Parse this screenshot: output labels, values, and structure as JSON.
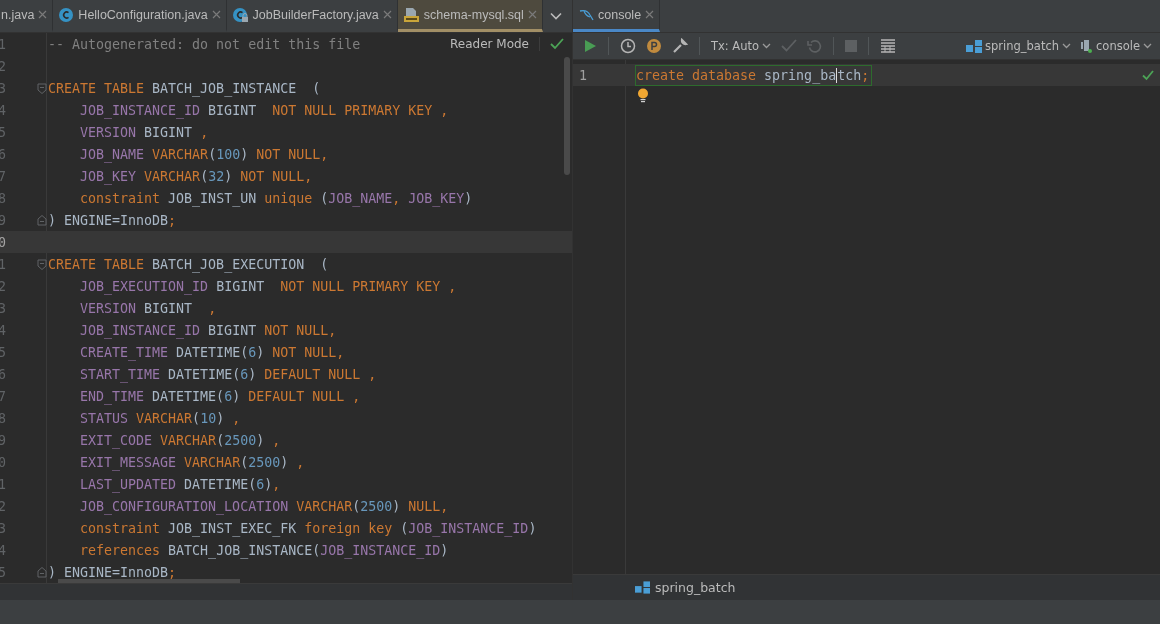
{
  "left_pane": {
    "tabs": [
      {
        "label": "n.java",
        "kind": "plain",
        "selected": false
      },
      {
        "label": "HelloConfiguration.java",
        "kind": "class",
        "selected": false
      },
      {
        "label": "JobBuilderFactory.java",
        "kind": "class-locked",
        "selected": false
      },
      {
        "label": "schema-mysql.sql",
        "kind": "sql",
        "selected": true
      }
    ],
    "reader_mode": "Reader Mode",
    "lines": [
      {
        "number": "1",
        "current": false,
        "tokens": [
          {
            "kind": "comment",
            "text": "-- Autogenerated: do not edit this file"
          }
        ]
      },
      {
        "number": "2",
        "current": false
      },
      {
        "number": "3",
        "current": false,
        "kind": "fold-start",
        "tokens": [
          {
            "kind": "kw",
            "text": "CREATE TABLE "
          },
          {
            "kind": "plain",
            "text": "BATCH_JOB_INSTANCE  ("
          }
        ]
      },
      {
        "number": "4",
        "current": false,
        "tokens": [
          {
            "kind": "col",
            "text": "    JOB_INSTANCE_ID "
          },
          {
            "kind": "plain",
            "text": "BIGINT  "
          },
          {
            "kind": "kw",
            "text": "NOT NULL PRIMARY KEY ,"
          }
        ]
      },
      {
        "number": "5",
        "current": false,
        "tokens": [
          {
            "kind": "col",
            "text": "    VERSION "
          },
          {
            "kind": "plain",
            "text": "BIGINT "
          },
          {
            "kind": "kw",
            "text": ","
          }
        ]
      },
      {
        "number": "6",
        "current": false,
        "tokens": [
          {
            "kind": "col",
            "text": "    JOB_NAME "
          },
          {
            "kind": "kw",
            "text": "VARCHAR"
          },
          {
            "kind": "plain",
            "text": "("
          },
          {
            "kind": "num",
            "text": "100"
          },
          {
            "kind": "plain",
            "text": ") "
          },
          {
            "kind": "kw",
            "text": "NOT NULL,"
          }
        ]
      },
      {
        "number": "7",
        "current": false,
        "tokens": [
          {
            "kind": "col",
            "text": "    JOB_KEY "
          },
          {
            "kind": "kw",
            "text": "VARCHAR"
          },
          {
            "kind": "plain",
            "text": "("
          },
          {
            "kind": "num",
            "text": "32"
          },
          {
            "kind": "plain",
            "text": ") "
          },
          {
            "kind": "kw",
            "text": "NOT NULL,"
          }
        ]
      },
      {
        "number": "8",
        "current": false,
        "tokens": [
          {
            "kind": "kw",
            "text": "    constraint "
          },
          {
            "kind": "plain",
            "text": "JOB_INST_UN "
          },
          {
            "kind": "kw",
            "text": "unique "
          },
          {
            "kind": "plain",
            "text": "("
          },
          {
            "kind": "col",
            "text": "JOB_NAME"
          },
          {
            "kind": "kw",
            "text": ", "
          },
          {
            "kind": "col",
            "text": "JOB_KEY"
          },
          {
            "kind": "plain",
            "text": ")"
          }
        ]
      },
      {
        "number": "9",
        "current": false,
        "kind": "fold-end",
        "tokens": [
          {
            "kind": "plain",
            "text": ") ENGINE=InnoDB"
          },
          {
            "kind": "kw",
            "text": ";"
          }
        ]
      },
      {
        "number": "0",
        "current": true
      },
      {
        "number": "1",
        "current": false,
        "kind": "fold-start",
        "tokens": [
          {
            "kind": "kw",
            "text": "CREATE TABLE "
          },
          {
            "kind": "plain",
            "text": "BATCH_JOB_EXECUTION  ("
          }
        ]
      },
      {
        "number": "2",
        "current": false,
        "tokens": [
          {
            "kind": "col",
            "text": "    JOB_EXECUTION_ID "
          },
          {
            "kind": "plain",
            "text": "BIGINT  "
          },
          {
            "kind": "kw",
            "text": "NOT NULL PRIMARY KEY ,"
          }
        ]
      },
      {
        "number": "3",
        "current": false,
        "tokens": [
          {
            "kind": "col",
            "text": "    VERSION "
          },
          {
            "kind": "plain",
            "text": "BIGINT  "
          },
          {
            "kind": "kw",
            "text": ","
          }
        ]
      },
      {
        "number": "4",
        "current": false,
        "tokens": [
          {
            "kind": "col",
            "text": "    JOB_INSTANCE_ID "
          },
          {
            "kind": "plain",
            "text": "BIGINT "
          },
          {
            "kind": "kw",
            "text": "NOT NULL,"
          }
        ]
      },
      {
        "number": "5",
        "current": false,
        "tokens": [
          {
            "kind": "col",
            "text": "    CREATE_TIME "
          },
          {
            "kind": "plain",
            "text": "DATETIME("
          },
          {
            "kind": "num",
            "text": "6"
          },
          {
            "kind": "plain",
            "text": ") "
          },
          {
            "kind": "kw",
            "text": "NOT NULL,"
          }
        ]
      },
      {
        "number": "6",
        "current": false,
        "tokens": [
          {
            "kind": "col",
            "text": "    START_TIME "
          },
          {
            "kind": "plain",
            "text": "DATETIME("
          },
          {
            "kind": "num",
            "text": "6"
          },
          {
            "kind": "plain",
            "text": ") "
          },
          {
            "kind": "kw",
            "text": "DEFAULT NULL ,"
          }
        ]
      },
      {
        "number": "7",
        "current": false,
        "tokens": [
          {
            "kind": "col",
            "text": "    END_TIME "
          },
          {
            "kind": "plain",
            "text": "DATETIME("
          },
          {
            "kind": "num",
            "text": "6"
          },
          {
            "kind": "plain",
            "text": ") "
          },
          {
            "kind": "kw",
            "text": "DEFAULT NULL ,"
          }
        ]
      },
      {
        "number": "8",
        "current": false,
        "tokens": [
          {
            "kind": "col",
            "text": "    STATUS "
          },
          {
            "kind": "kw",
            "text": "VARCHAR"
          },
          {
            "kind": "plain",
            "text": "("
          },
          {
            "kind": "num",
            "text": "10"
          },
          {
            "kind": "plain",
            "text": ") "
          },
          {
            "kind": "kw",
            "text": ","
          }
        ]
      },
      {
        "number": "9",
        "current": false,
        "tokens": [
          {
            "kind": "col",
            "text": "    EXIT_CODE "
          },
          {
            "kind": "kw",
            "text": "VARCHAR"
          },
          {
            "kind": "plain",
            "text": "("
          },
          {
            "kind": "num",
            "text": "2500"
          },
          {
            "kind": "plain",
            "text": ") "
          },
          {
            "kind": "kw",
            "text": ","
          }
        ]
      },
      {
        "number": "0",
        "current": false,
        "tokens": [
          {
            "kind": "col",
            "text": "    EXIT_MESSAGE "
          },
          {
            "kind": "kw",
            "text": "VARCHAR"
          },
          {
            "kind": "plain",
            "text": "("
          },
          {
            "kind": "num",
            "text": "2500"
          },
          {
            "kind": "plain",
            "text": ") "
          },
          {
            "kind": "kw",
            "text": ","
          }
        ]
      },
      {
        "number": "1",
        "current": false,
        "tokens": [
          {
            "kind": "col",
            "text": "    LAST_UPDATED "
          },
          {
            "kind": "plain",
            "text": "DATETIME("
          },
          {
            "kind": "num",
            "text": "6"
          },
          {
            "kind": "plain",
            "text": ")"
          },
          {
            "kind": "kw",
            "text": ","
          }
        ]
      },
      {
        "number": "2",
        "current": false,
        "tokens": [
          {
            "kind": "col",
            "text": "    JOB_CONFIGURATION_LOCATION "
          },
          {
            "kind": "kw",
            "text": "VARCHAR"
          },
          {
            "kind": "plain",
            "text": "("
          },
          {
            "kind": "num",
            "text": "2500"
          },
          {
            "kind": "plain",
            "text": ") "
          },
          {
            "kind": "kw",
            "text": "NULL,"
          }
        ]
      },
      {
        "number": "3",
        "current": false,
        "tokens": [
          {
            "kind": "kw",
            "text": "    constraint "
          },
          {
            "kind": "plain",
            "text": "JOB_INST_EXEC_FK "
          },
          {
            "kind": "kw",
            "text": "foreign key "
          },
          {
            "kind": "plain",
            "text": "("
          },
          {
            "kind": "col",
            "text": "JOB_INSTANCE_ID"
          },
          {
            "kind": "plain",
            "text": ")"
          }
        ]
      },
      {
        "number": "4",
        "current": false,
        "tokens": [
          {
            "kind": "kw",
            "text": "    references "
          },
          {
            "kind": "plain",
            "text": "BATCH_JOB_INSTANCE("
          },
          {
            "kind": "col",
            "text": "JOB_INSTANCE_ID"
          },
          {
            "kind": "plain",
            "text": ")"
          }
        ]
      },
      {
        "number": "5",
        "current": false,
        "kind": "fold-end",
        "tokens": [
          {
            "kind": "plain",
            "text": ") ENGINE=InnoDB"
          },
          {
            "kind": "kw",
            "text": ";"
          }
        ]
      }
    ]
  },
  "right_pane": {
    "tabs": [
      {
        "label": "console",
        "selected": true
      }
    ],
    "toolbar": {
      "tx_mode": "Tx: Auto",
      "commit_disabled": true,
      "rollback_disabled": true,
      "stop_disabled": true,
      "datasource": "spring_batch",
      "session": "console"
    },
    "lines": [
      {
        "number": "1",
        "current": true,
        "boxed": true,
        "tokens": [
          {
            "kind": "kw",
            "text": "create database "
          },
          {
            "kind": "plain",
            "text": "spring_ba"
          },
          {
            "kind": "plain",
            "text": "tch",
            "caret": true
          },
          {
            "kind": "kw",
            "text": ";"
          }
        ]
      }
    ],
    "status": "spring_batch"
  }
}
